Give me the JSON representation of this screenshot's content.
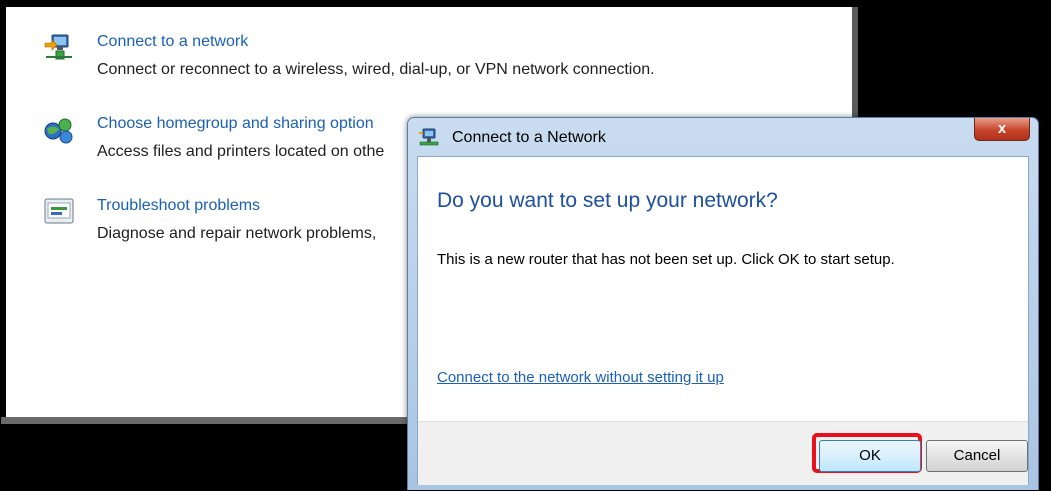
{
  "panel": {
    "tasks": [
      {
        "icon": "network-connect-icon",
        "link": "Connect to a network",
        "description": "Connect or reconnect to a wireless, wired, dial-up, or VPN network connection."
      },
      {
        "icon": "homegroup-icon",
        "link": "Choose homegroup and sharing option",
        "description": "Access files and printers located on othe"
      },
      {
        "icon": "troubleshoot-icon",
        "link": "Troubleshoot problems",
        "description": "Diagnose and repair network problems,"
      }
    ]
  },
  "dialog": {
    "title": "Connect to a Network",
    "close_label": "x",
    "heading": "Do you want to set up your network?",
    "body": "This is a new router that has not been set up. Click OK to start setup.",
    "alt_link": "Connect to the network without setting it up",
    "ok_label": "OK",
    "cancel_label": "Cancel",
    "highlight_color": "#e8101c"
  }
}
